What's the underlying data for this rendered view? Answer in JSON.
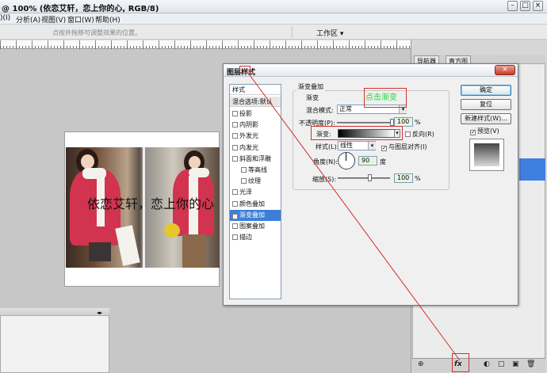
{
  "window": {
    "title": "@ 100% (依恋艾轩，恋上你的心, RGB/8)",
    "controls": [
      "–",
      "□",
      "×"
    ]
  },
  "menubar": {
    "items": [
      ")(I)",
      "分析(A)",
      "视图(V)",
      "窗口(W)",
      "帮助(H)"
    ]
  },
  "options_bar": {
    "hint": "点按并拖移可调整效果的位置。",
    "workspace": "工作区 ▾"
  },
  "document": {
    "overlay_text": "依恋艾轩，恋上你的心"
  },
  "right_panel": {
    "tabs": [
      "导航器",
      "直方图"
    ],
    "bottom_icons": [
      "⊕",
      "fx",
      "◐",
      "□",
      "▣",
      "🗑"
    ]
  },
  "dialog": {
    "title": "图层样式",
    "close": "×",
    "style_list": {
      "header": "样式",
      "blend_options": "混合选项:默认",
      "items": [
        {
          "label": "投影",
          "checked": false,
          "sub": false
        },
        {
          "label": "内阴影",
          "checked": false,
          "sub": false
        },
        {
          "label": "外发光",
          "checked": false,
          "sub": false
        },
        {
          "label": "内发光",
          "checked": false,
          "sub": false
        },
        {
          "label": "斜面和浮雕",
          "checked": false,
          "sub": false
        },
        {
          "label": "等高线",
          "checked": false,
          "sub": true
        },
        {
          "label": "纹理",
          "checked": false,
          "sub": true
        },
        {
          "label": "光泽",
          "checked": false,
          "sub": false
        },
        {
          "label": "颜色叠加",
          "checked": false,
          "sub": false
        },
        {
          "label": "渐变叠加",
          "checked": true,
          "sub": false,
          "selected": true
        },
        {
          "label": "图案叠加",
          "checked": false,
          "sub": false
        },
        {
          "label": "描边",
          "checked": false,
          "sub": false
        }
      ]
    },
    "group_title": "渐变叠加",
    "group_subtitle": "渐变",
    "blend_mode_label": "混合模式:",
    "blend_mode_value": "正常",
    "opacity_label": "不透明度(P):",
    "opacity_value": "100",
    "opacity_unit": "%",
    "opacity_level": 1.0,
    "gradient_label": "渐变:",
    "reverse_label": "反向(R)",
    "reverse_checked": false,
    "style_label": "样式(L):",
    "style_value": "线性",
    "align_label": "与图层对齐(I)",
    "align_checked": true,
    "angle_label": "角度(N):",
    "angle_value": "90",
    "angle_unit": "度",
    "scale_label": "缩放(S):",
    "scale_value": "100",
    "scale_unit": "%",
    "scale_level": 1.0,
    "ok_button": "确定",
    "reset_button": "复位",
    "new_style_button": "新建样式(W)...",
    "preview_label": "预览(V)",
    "preview_checked": true
  },
  "annotation": {
    "text": "点击渐变",
    "color": "#2bd13c",
    "box_color": "#d0312d"
  }
}
